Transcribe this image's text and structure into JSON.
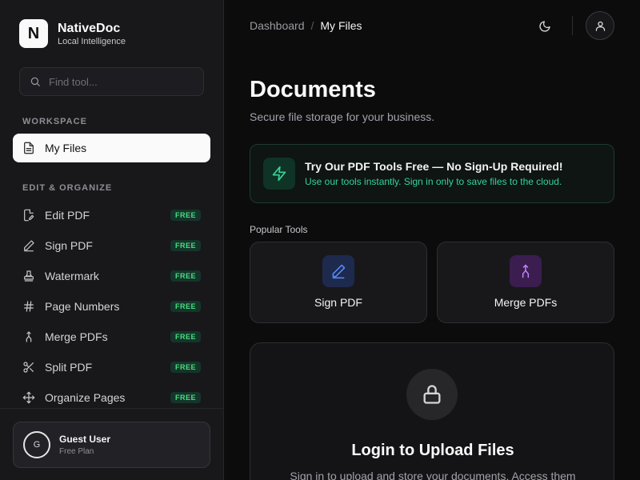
{
  "brand": {
    "logo_letter": "N",
    "name": "NativeDoc",
    "tagline": "Local Intelligence"
  },
  "search": {
    "placeholder": "Find tool...",
    "value": ""
  },
  "sidebar": {
    "workspace_label": "WORKSPACE",
    "active_item": {
      "label": "My Files",
      "icon": "file-text-icon"
    },
    "edit_label": "EDIT & ORGANIZE",
    "items": [
      {
        "label": "Edit PDF",
        "badge": "FREE",
        "icon": "edit-file-icon"
      },
      {
        "label": "Sign PDF",
        "badge": "FREE",
        "icon": "pen-icon"
      },
      {
        "label": "Watermark",
        "badge": "FREE",
        "icon": "stamp-icon"
      },
      {
        "label": "Page Numbers",
        "badge": "FREE",
        "icon": "hash-icon"
      },
      {
        "label": "Merge PDFs",
        "badge": "FREE",
        "icon": "merge-icon"
      },
      {
        "label": "Split PDF",
        "badge": "FREE",
        "icon": "scissors-icon"
      },
      {
        "label": "Organize Pages",
        "badge": "FREE",
        "icon": "move-icon"
      }
    ]
  },
  "user": {
    "initial": "G",
    "name": "Guest User",
    "plan": "Free Plan"
  },
  "header": {
    "breadcrumb_root": "Dashboard",
    "breadcrumb_sep": "/",
    "breadcrumb_current": "My Files"
  },
  "main": {
    "title": "Documents",
    "subtitle": "Secure file storage for your business.",
    "promo": {
      "title": "Try Our PDF Tools Free — No Sign-Up Required!",
      "desc": "Use our tools instantly. Sign in only to save files to the cloud."
    },
    "tools_label": "Popular Tools",
    "tools": [
      {
        "label": "Sign PDF",
        "icon": "pen-icon",
        "color": "#5b8cff"
      },
      {
        "label": "Merge PDFs",
        "icon": "merge-icon",
        "color": "#c084fc"
      }
    ],
    "upload": {
      "title": "Login to Upload Files",
      "desc": "Sign in to upload and store your documents. Access them"
    }
  },
  "colors": {
    "accent_green": "#34d399",
    "badge_green": "#4ade80",
    "bg": "#0c0c0d",
    "sidebar_bg": "#18181b"
  }
}
